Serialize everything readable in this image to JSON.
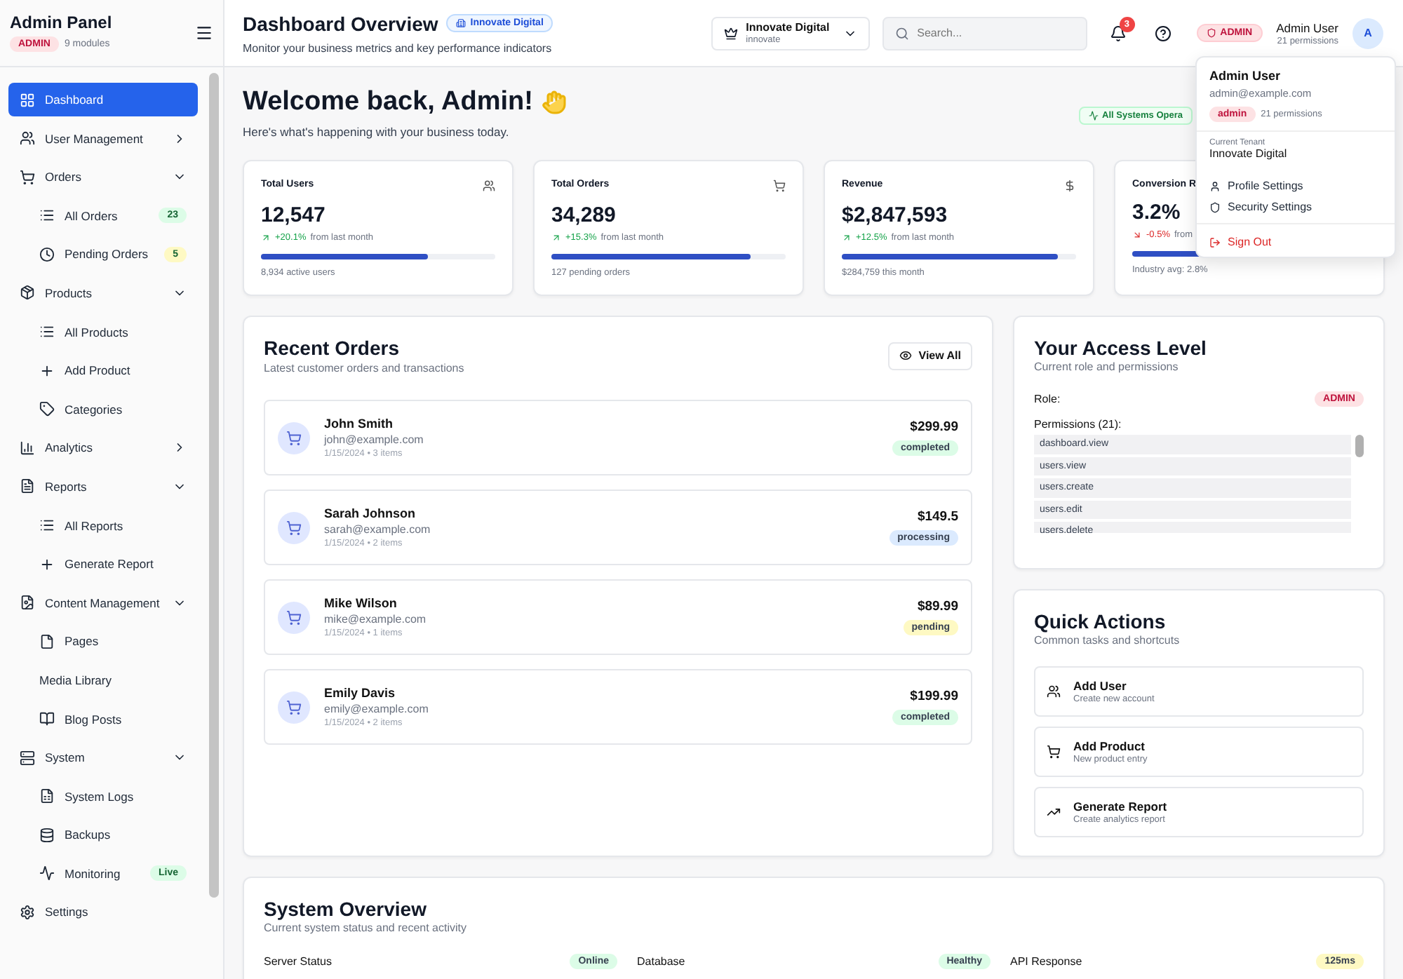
{
  "sidebar": {
    "title": "Admin Panel",
    "role_badge": "ADMIN",
    "modules": "9 modules",
    "items": [
      {
        "label": "Dashboard",
        "selected": true
      },
      {
        "label": "User Management",
        "selected": false,
        "expanded": false
      },
      {
        "label": "Orders",
        "selected": false,
        "expanded": true,
        "children": [
          {
            "label": "All Orders",
            "selected": false,
            "badge": {
              "text": "23",
              "color": "#dcfce7"
            }
          },
          {
            "label": "Pending Orders",
            "selected": false,
            "badge": {
              "text": "5",
              "color": "#fef9c3"
            }
          }
        ]
      },
      {
        "label": "Products",
        "selected": false,
        "expanded": true,
        "children": [
          {
            "label": "All Products",
            "selected": false
          },
          {
            "label": "Add Product",
            "selected": false
          },
          {
            "label": "Categories",
            "selected": false
          }
        ]
      },
      {
        "label": "Analytics",
        "selected": false,
        "expanded": false
      },
      {
        "label": "Reports",
        "selected": false,
        "expanded": true,
        "children": [
          {
            "label": "All Reports",
            "selected": false
          },
          {
            "label": "Generate Report",
            "selected": false
          }
        ]
      },
      {
        "label": "Content Management",
        "selected": false,
        "expanded": true,
        "children": [
          {
            "label": "Pages",
            "selected": false
          },
          {
            "label": "Media Library",
            "selected": false
          },
          {
            "label": "Blog Posts",
            "selected": false
          }
        ]
      },
      {
        "label": "System",
        "selected": false,
        "expanded": true,
        "children": [
          {
            "label": "System Logs",
            "selected": false
          },
          {
            "label": "Backups",
            "selected": false
          },
          {
            "label": "Monitoring",
            "selected": false,
            "badge": {
              "text": "Live",
              "color": "#dcfce7"
            }
          }
        ]
      },
      {
        "label": "Settings",
        "selected": false
      }
    ]
  },
  "header": {
    "title": "Dashboard Overview",
    "tenant_badge": "Innovate Digital",
    "subtitle": "Monitor your business metrics and key performance indicators",
    "tenant_select": {
      "name": "Innovate Digital",
      "slug": "innovate"
    },
    "search": {
      "placeholder": "Search..."
    },
    "notifications": "3",
    "role_badge": "ADMIN",
    "user_name": "Admin User",
    "user_permissions": "21 permissions",
    "avatar": "A"
  },
  "user_menu": {
    "name": "Admin User",
    "email": "admin@example.com",
    "role": "admin",
    "permissions": "21 permissions",
    "tenant_label": "Current Tenant",
    "tenant": "Innovate Digital",
    "items": [
      {
        "label": "Profile Settings",
        "kind": "normal"
      },
      {
        "label": "Security Settings",
        "kind": "normal"
      },
      {
        "label": "Sign Out",
        "kind": "danger"
      }
    ]
  },
  "welcome": {
    "title": "Welcome back, Admin!",
    "subtitle": "Here's what's happening with your business today.",
    "status_badge": "All Systems Opera"
  },
  "stats": [
    {
      "title": "Total Users",
      "value": "12,547",
      "trend_up": true,
      "change": "+20.1%",
      "change_text": "from last month",
      "level": 0.71,
      "footer": "8,934 active users"
    },
    {
      "title": "Total Orders",
      "value": "34,289",
      "trend_up": true,
      "change": "+15.3%",
      "change_text": "from last month",
      "level": 0.85,
      "footer": "127 pending orders"
    },
    {
      "title": "Revenue",
      "value": "$2,847,593",
      "trend_up": true,
      "change": "+12.5%",
      "change_text": "from last month",
      "level": 0.92,
      "footer": "$284,759 this month"
    },
    {
      "title": "Conversion R",
      "value": "3.2%",
      "trend_up": false,
      "change": "-0.5%",
      "change_text": "from",
      "level": 0.3,
      "footer": "Industry avg: 2.8%"
    }
  ],
  "recent_orders": {
    "title": "Recent Orders",
    "subtitle": "Latest customer orders and transactions",
    "button": "View All",
    "orders": [
      {
        "name": "John Smith",
        "email": "john@example.com",
        "meta": "1/15/2024 • 3 items",
        "amount": "$299.99",
        "status": "completed",
        "color": "#dcfce7"
      },
      {
        "name": "Sarah Johnson",
        "email": "sarah@example.com",
        "meta": "1/15/2024 • 2 items",
        "amount": "$149.5",
        "status": "processing",
        "color": "#dbeafe"
      },
      {
        "name": "Mike Wilson",
        "email": "mike@example.com",
        "meta": "1/15/2024 • 1 items",
        "amount": "$89.99",
        "status": "pending",
        "color": "#fef9c3"
      },
      {
        "name": "Emily Davis",
        "email": "emily@example.com",
        "meta": "1/15/2024 • 2 items",
        "amount": "$199.99",
        "status": "completed",
        "color": "#dcfce7"
      }
    ]
  },
  "access": {
    "title": "Your Access Level",
    "subtitle": "Current role and permissions",
    "role_label": "Role:",
    "role": "ADMIN",
    "permissions_label": "Permissions (21):",
    "permissions": [
      "dashboard.view",
      "users.view",
      "users.create",
      "users.edit",
      "users.delete"
    ]
  },
  "quick_actions": {
    "title": "Quick Actions",
    "subtitle": "Common tasks and shortcuts",
    "actions": [
      {
        "title": "Add User",
        "subtitle": "Create new account"
      },
      {
        "title": "Add Product",
        "subtitle": "New product entry"
      },
      {
        "title": "Generate Report",
        "subtitle": "Create analytics report"
      }
    ]
  },
  "system_overview": {
    "title": "System Overview",
    "subtitle": "Current system status and recent activity",
    "statuses": [
      {
        "label": "Server Status",
        "value": "Online",
        "color": "#dcfce7"
      },
      {
        "label": "Database",
        "value": "Healthy",
        "color": "#dcfce7"
      },
      {
        "label": "API Response",
        "value": "125ms",
        "color": "#fef9c3"
      }
    ]
  }
}
